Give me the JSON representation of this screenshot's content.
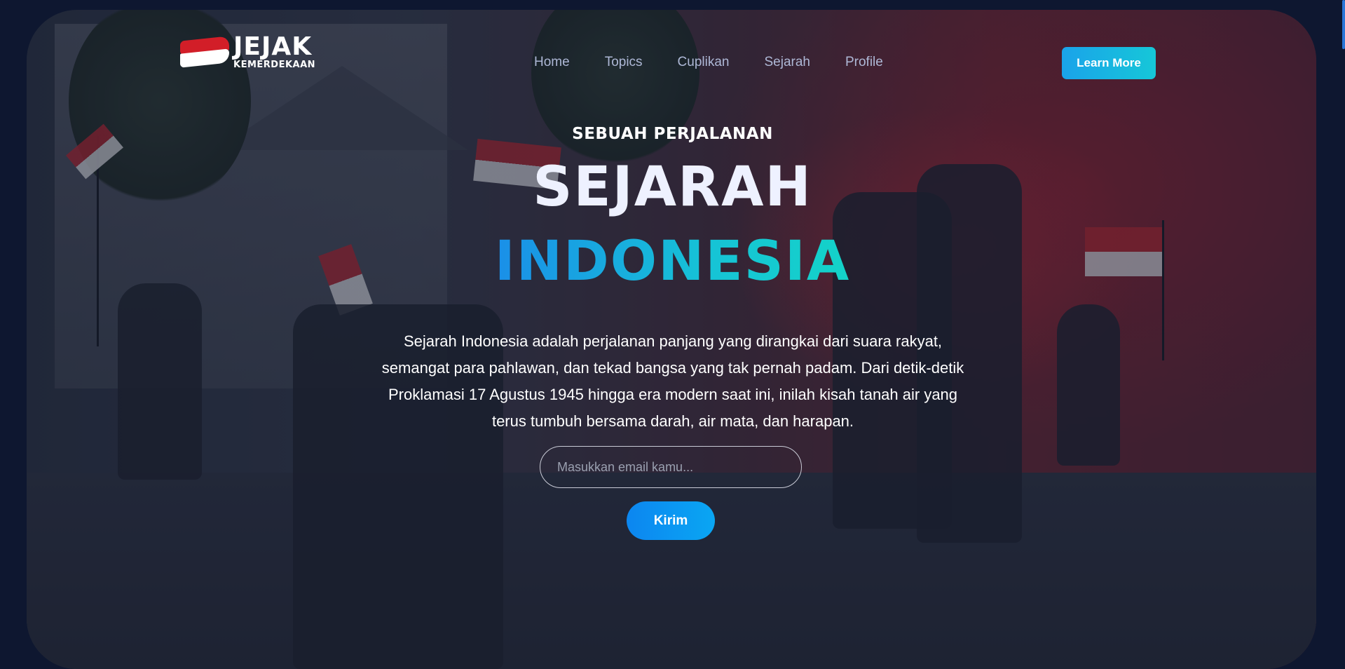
{
  "brand": {
    "name": "JEJAK",
    "tagline": "KEMERDEKAAN"
  },
  "nav": {
    "items": [
      {
        "label": "Home"
      },
      {
        "label": "Topics"
      },
      {
        "label": "Cuplikan"
      },
      {
        "label": "Sejarah"
      },
      {
        "label": "Profile"
      }
    ],
    "cta_label": "Learn More"
  },
  "hero": {
    "kicker": "SEBUAH PERJALANAN",
    "title_line1": "SEJARAH",
    "title_line2": "INDONESIA",
    "description": "Sejarah Indonesia adalah perjalanan panjang yang dirangkai dari suara rakyat, semangat para pahlawan, dan tekad bangsa yang tak pernah padam. Dari detik-detik Proklamasi 17 Agustus 1945 hingga era modern saat ini, inilah kisah tanah air yang terus tumbuh bersama darah, air mata, dan harapan.",
    "email_placeholder": "Masukkan email kamu...",
    "email_value": "",
    "submit_label": "Kirim"
  },
  "colors": {
    "page_background": "#0e1730",
    "accent_gradient_start": "#1aa3ea",
    "accent_gradient_end": "#16c7d8",
    "flag_red": "#d21e28",
    "flag_white": "#ffffff"
  },
  "icons": {
    "logo": "indonesian-flag-icon"
  }
}
